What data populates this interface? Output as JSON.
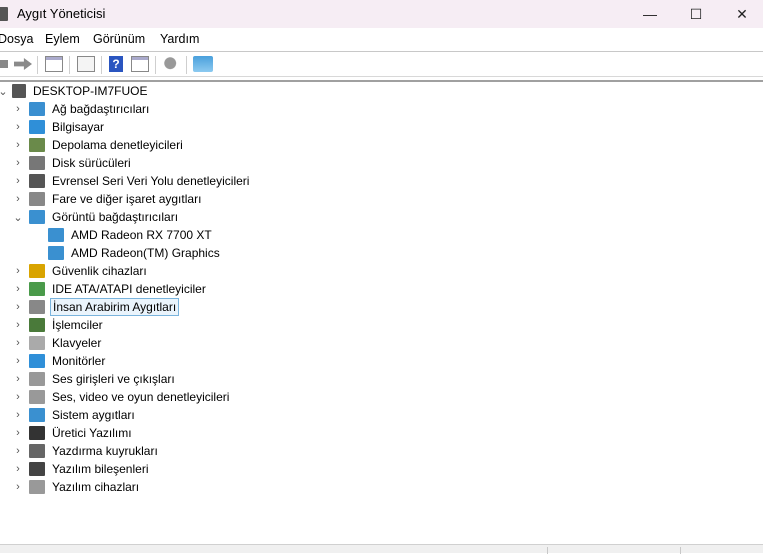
{
  "window": {
    "title": "Aygıt Yöneticisi",
    "minimize": "—",
    "maximize": "☐",
    "close": "✕"
  },
  "menu": [
    "Dosya",
    "Eylem",
    "Görünüm",
    "Yardım"
  ],
  "toolbar": [
    "back-icon",
    "forward-icon",
    "show-hide-console-tree-icon",
    "properties-icon",
    "help-icon",
    "action-pane-icon",
    "update-driver-icon",
    "scan-hardware-icon"
  ],
  "tree": {
    "root": "DESKTOP-IM7FUOE",
    "items": [
      {
        "label": "Ağ bağdaştırıcıları",
        "icon": "network-adapter-icon",
        "color": "#3a8fd0"
      },
      {
        "label": "Bilgisayar",
        "icon": "computer-icon",
        "color": "#2f8fd8"
      },
      {
        "label": "Depolama denetleyicileri",
        "icon": "storage-controller-icon",
        "color": "#6a8a4a"
      },
      {
        "label": "Disk sürücüleri",
        "icon": "disk-drive-icon",
        "color": "#777777"
      },
      {
        "label": "Evrensel Seri Veri Yolu denetleyicileri",
        "icon": "usb-icon",
        "color": "#555555"
      },
      {
        "label": "Fare ve diğer işaret aygıtları",
        "icon": "mouse-icon",
        "color": "#888888"
      },
      {
        "label": "Görüntü bağdaştırıcıları",
        "icon": "display-adapter-icon",
        "color": "#3a90d0",
        "expanded": true,
        "children": [
          {
            "label": "AMD Radeon RX 7700 XT",
            "icon": "display-adapter-icon"
          },
          {
            "label": "AMD Radeon(TM) Graphics",
            "icon": "display-adapter-icon"
          }
        ]
      },
      {
        "label": "Güvenlik cihazları",
        "icon": "security-device-icon",
        "color": "#d9a400"
      },
      {
        "label": "IDE ATA/ATAPI denetleyiciler",
        "icon": "ide-controller-icon",
        "color": "#4a9a4a"
      },
      {
        "label": "İnsan Arabirim Aygıtları",
        "icon": "hid-icon",
        "color": "#888888",
        "selected": true
      },
      {
        "label": "İşlemciler",
        "icon": "processor-icon",
        "color": "#4a7a3a"
      },
      {
        "label": "Klavyeler",
        "icon": "keyboard-icon",
        "color": "#aaaaaa"
      },
      {
        "label": "Monitörler",
        "icon": "monitor-icon",
        "color": "#2f8fd8"
      },
      {
        "label": "Ses girişleri ve çıkışları",
        "icon": "speaker-icon",
        "color": "#999999"
      },
      {
        "label": "Ses, video ve oyun denetleyicileri",
        "icon": "speaker-icon",
        "color": "#999999"
      },
      {
        "label": "Sistem aygıtları",
        "icon": "system-devices-icon",
        "color": "#3a90d0"
      },
      {
        "label": "Üretici Yazılımı",
        "icon": "firmware-icon",
        "color": "#333333"
      },
      {
        "label": "Yazdırma kuyrukları",
        "icon": "printer-icon",
        "color": "#666666"
      },
      {
        "label": "Yazılım bileşenleri",
        "icon": "software-component-icon",
        "color": "#444444"
      },
      {
        "label": "Yazılım cihazları",
        "icon": "software-device-icon",
        "color": "#999999"
      }
    ]
  }
}
